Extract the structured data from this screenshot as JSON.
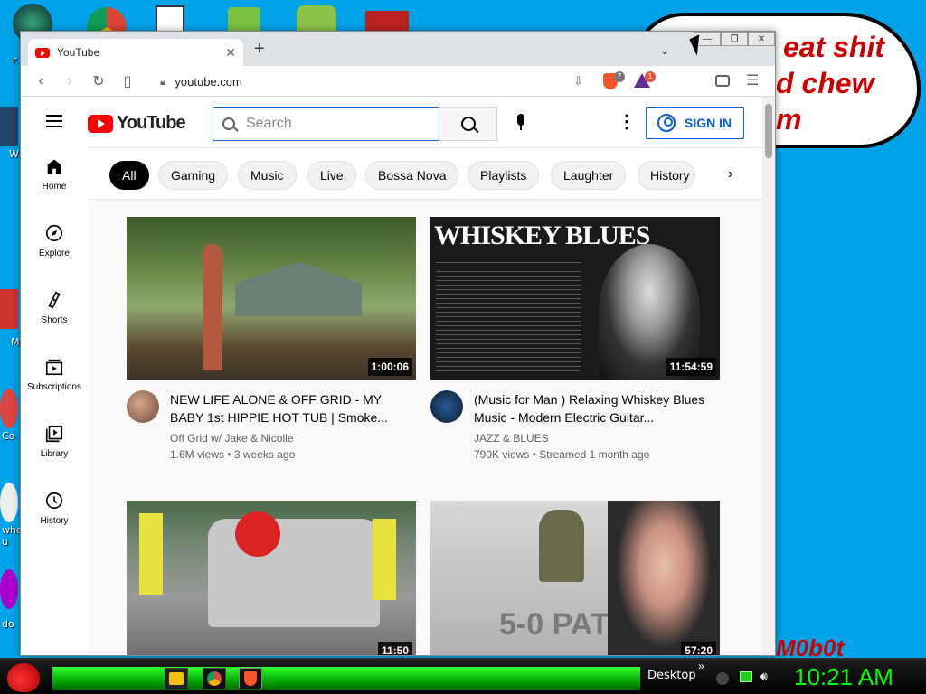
{
  "desktop": {
    "icon_labels": [
      "r",
      "W",
      "M",
      "Co",
      "whe u",
      "do"
    ],
    "speech_lines": [
      "eat shit",
      "d chew",
      "m"
    ],
    "signature": "M0b0t"
  },
  "browser": {
    "tab_title": "YouTube",
    "url": "youtube.com",
    "brave_badge": "7",
    "rewards_badge": "1"
  },
  "youtube": {
    "logo_text": "YouTube",
    "search_placeholder": "Search",
    "signin_label": "SIGN IN",
    "sidebar": [
      {
        "label": "Home",
        "icon": "home-icon"
      },
      {
        "label": "Explore",
        "icon": "compass-icon"
      },
      {
        "label": "Shorts",
        "icon": "shorts-icon"
      },
      {
        "label": "Subscriptions",
        "icon": "subscriptions-icon"
      },
      {
        "label": "Library",
        "icon": "library-icon"
      },
      {
        "label": "History",
        "icon": "history-icon"
      }
    ],
    "chips": [
      "All",
      "Gaming",
      "Music",
      "Live",
      "Bossa Nova",
      "Playlists",
      "Laughter",
      "History"
    ],
    "videos": [
      {
        "title": "NEW LIFE ALONE & OFF GRID - MY BABY 1st HIPPIE HOT TUB | Smoke...",
        "channel": "Off Grid w/ Jake & Nicolle",
        "stats": "1.6M views • 3 weeks ago",
        "duration": "1:00:06"
      },
      {
        "title": "(Music for Man ) Relaxing Whiskey Blues Music - Modern Electric Guitar...",
        "channel": "JAZZ & BLUES",
        "stats": "790K views • Streamed 1 month ago",
        "duration": "11:54:59",
        "thumb_text": "WHISKEY BLUES"
      },
      {
        "duration": "11:50"
      },
      {
        "duration": "57:20",
        "thumb_text": "5-0 PAT"
      }
    ]
  },
  "taskbar": {
    "desktop_label": "Desktop",
    "clock": "10:21 AM"
  }
}
